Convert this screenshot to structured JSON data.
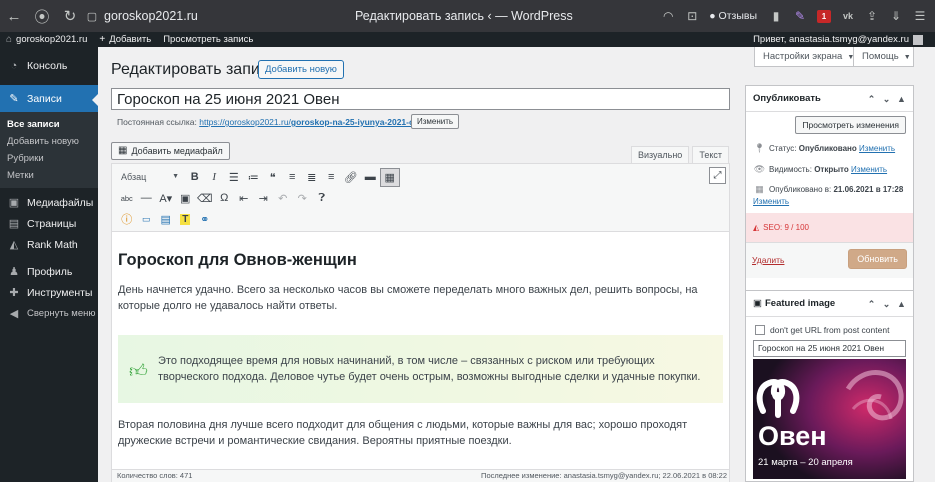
{
  "browser": {
    "url_host": "goroskop2021.ru",
    "tab_title": "Редактировать запись ‹ — WordPress",
    "reviews_label": "Отзывы",
    "badge_num": "1"
  },
  "adminbar": {
    "site": "goroskop2021.ru",
    "add": "Добавить",
    "view": "Просмотреть запись",
    "greeting": "Привет, anastasia.tsmyg@yandex.ru"
  },
  "sidebar": {
    "items": [
      {
        "label": "Консоль",
        "icon": "dashboard-icon"
      },
      {
        "label": "Записи",
        "icon": "pin-icon"
      },
      {
        "label": "Медиафайлы",
        "icon": "media-icon"
      },
      {
        "label": "Страницы",
        "icon": "pages-icon"
      },
      {
        "label": "Rank Math",
        "icon": "rankmath-icon"
      },
      {
        "label": "Профиль",
        "icon": "user-icon"
      },
      {
        "label": "Инструменты",
        "icon": "tools-icon"
      },
      {
        "label": "Свернуть меню",
        "icon": "collapse-icon"
      }
    ],
    "sub": [
      "Все записи",
      "Добавить новую",
      "Рубрики",
      "Метки"
    ]
  },
  "page": {
    "title": "Редактировать запись",
    "add_new": "Добавить новую",
    "screen_options": "Настройки экрана",
    "help": "Помощь",
    "post_title": "Гороскоп на 25 июня 2021 Овен",
    "permalink_label": "Постоянная ссылка:",
    "permalink_base": "https://goroskop2021.ru/",
    "permalink_slug": "goroskop-na-25-iyunya-2021-oven",
    "permalink_end": "/",
    "permalink_edit": "Изменить",
    "add_media": "Добавить медиафайл",
    "tab_visual": "Визуально",
    "tab_text": "Текст",
    "format_select": "Абзац"
  },
  "content": {
    "heading": "Гороскоп для Овнов-женщин",
    "p1": "День начнется удачно. Всего за несколько часов вы сможете переделать много важных дел, решить вопросы, на которые долго не удавалось найти ответы.",
    "tip": "Это подходящее время для новых начинаний, в том числе – связанных с риском или требующих творческого подхода. Деловое чутье будет очень острым, возможны выгодные сделки и удачные покупки.",
    "p2": "Вторая половина дня лучше всего подходит для общения с людьми, которые важны для вас; хорошо проходят дружеские встречи и романтические свидания. Вероятны приятные поездки."
  },
  "status": {
    "word_count": "Количество слов: 471",
    "last_modified": "Последнее изменение: anastasia.tsmyg@yandex.ru; 22.06.2021 в 08:22"
  },
  "publish": {
    "title": "Опубликовать",
    "preview": "Просмотреть изменения",
    "status_label": "Статус:",
    "status_value": "Опубликовано",
    "visibility_label": "Видимость:",
    "visibility_value": "Открыто",
    "published_label": "Опубликовано в:",
    "published_value": "21.06.2021 в 17:28",
    "edit": "Изменить",
    "seo_label": "SEO: 9 / 100",
    "delete": "Удалить",
    "update": "Обновить"
  },
  "featured": {
    "title": "Featured image",
    "checkbox_label": "don't get URL from post content",
    "input_value": "Гороскоп на 25 июня 2021 Овен",
    "image_title": "Овен",
    "image_dates": "21 марта – 20 апреля"
  },
  "colors": {
    "accent": "#2271b1",
    "sidebar": "#1d2327",
    "active_menu": "#2271b1",
    "update_button": "#d0a988",
    "seo_bg": "#fae2e4",
    "tip_icon": "#3aa63f"
  }
}
